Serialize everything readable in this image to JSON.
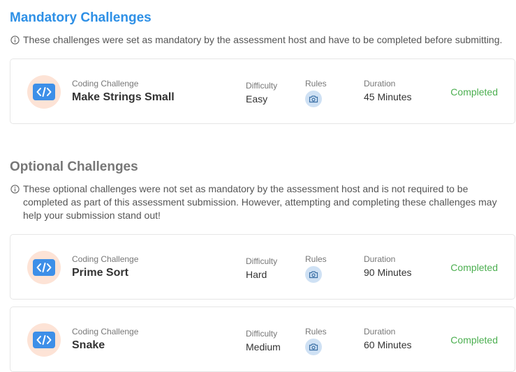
{
  "mandatory": {
    "title": "Mandatory Challenges",
    "note": "These challenges were set as mandatory by the assessment host and have to be completed before submitting.",
    "challenges": [
      {
        "type": "Coding Challenge",
        "name": "Make Strings Small",
        "difficulty_label": "Difficulty",
        "difficulty": "Easy",
        "rules_label": "Rules",
        "duration_label": "Duration",
        "duration": "45 Minutes",
        "status": "Completed"
      }
    ]
  },
  "optional": {
    "title": "Optional Challenges",
    "note": "These optional challenges were not set as mandatory by the assessment host and is not required to be completed as part of this assessment submission. However, attempting and completing these challenges may help your submission stand out!",
    "challenges": [
      {
        "type": "Coding Challenge",
        "name": "Prime Sort",
        "difficulty_label": "Difficulty",
        "difficulty": "Hard",
        "rules_label": "Rules",
        "duration_label": "Duration",
        "duration": "90 Minutes",
        "status": "Completed"
      },
      {
        "type": "Coding Challenge",
        "name": "Snake",
        "difficulty_label": "Difficulty",
        "difficulty": "Medium",
        "rules_label": "Rules",
        "duration_label": "Duration",
        "duration": "60 Minutes",
        "status": "Completed"
      }
    ]
  },
  "icons": {
    "note": "info-circle-icon",
    "challenge": "code-icon",
    "rules": "camera-icon"
  },
  "colors": {
    "mandatory_title": "#2e90e6",
    "optional_title": "#777777",
    "completed": "#4caf50",
    "code_icon": "#3d8fe8",
    "code_icon_bg": "#fde3d6",
    "rules_icon_bg": "#cfe1f4"
  }
}
